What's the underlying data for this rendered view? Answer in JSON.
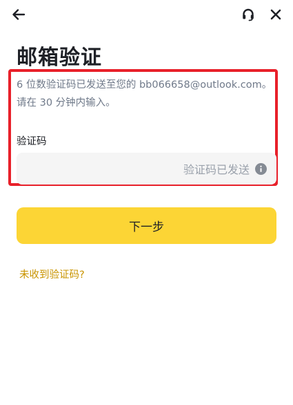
{
  "header": {
    "back_icon": "arrow-left-icon",
    "support_icon": "headset-icon",
    "close_icon": "close-icon"
  },
  "title": "邮箱验证",
  "description": {
    "line1": "6 位数验证码已发送至您的 bb066658@outlook.com。",
    "line2": "请在 30 分钟内输入。"
  },
  "code_field": {
    "label": "验证码",
    "value": "",
    "status": "验证码已发送",
    "status_icon": "info-icon"
  },
  "next_button": {
    "label": "下一步",
    "color": "#fcd535"
  },
  "resend_link": {
    "label": "未收到验证码?",
    "color": "#c99400"
  },
  "highlight_color": "#e8202a"
}
